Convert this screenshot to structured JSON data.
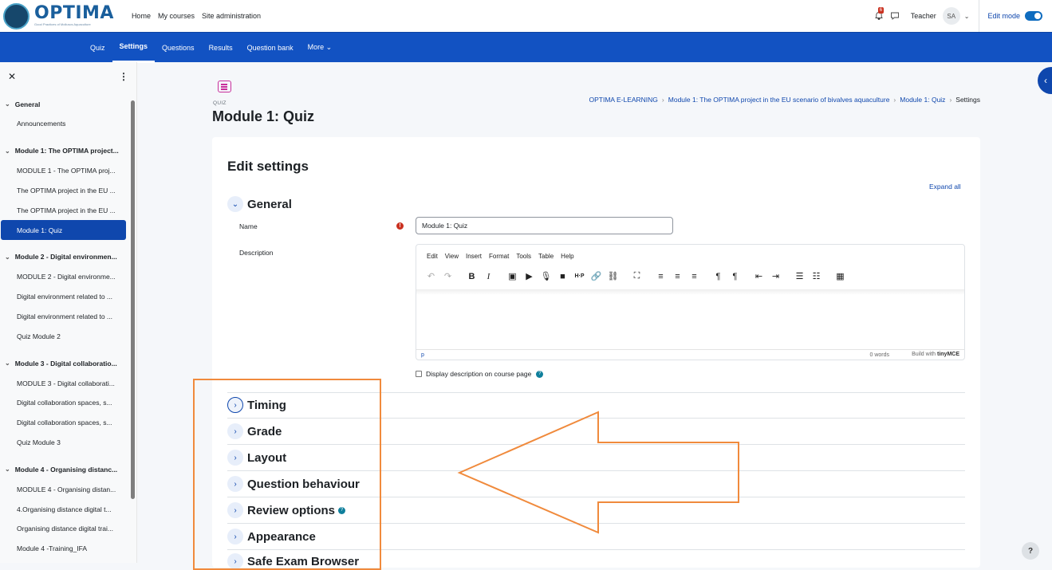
{
  "brand": {
    "title": "OPTIMA",
    "subtitle": "Good Practices of Molluscs Aquaculture"
  },
  "topnav": [
    "Home",
    "My courses",
    "Site administration"
  ],
  "user": {
    "notifications": "6",
    "role": "Teacher",
    "initials": "SA",
    "edit_mode_label": "Edit mode"
  },
  "secnav": [
    "Quiz",
    "Settings",
    "Questions",
    "Results",
    "Question bank",
    "More ⌄"
  ],
  "drawer": {
    "sections": [
      {
        "title": "General",
        "items": [
          "Announcements"
        ]
      },
      {
        "title": "Module 1: The OPTIMA project...",
        "items": [
          "MODULE 1 - The OPTIMA proj...",
          "The OPTIMA project in the EU ...",
          "The OPTIMA project in the EU ...",
          "Module 1: Quiz"
        ]
      },
      {
        "title": "Module 2 - Digital environmen...",
        "items": [
          "MODULE 2 - Digital environme...",
          "Digital environment related to ...",
          "Digital environment related to ...",
          "Quiz Module 2"
        ]
      },
      {
        "title": "Module 3 - Digital collaboratio...",
        "items": [
          "MODULE 3 - Digital collaborati...",
          "Digital collaboration spaces, s...",
          "Digital collaboration spaces, s...",
          "Quiz Module 3"
        ]
      },
      {
        "title": "Module 4 - Organising distanc...",
        "items": [
          "MODULE 4 - Organising distan...",
          "4.Organising distance digital t...",
          "Organising distance digital trai...",
          "Module 4 -Training_IFA"
        ]
      }
    ],
    "active_item": "Module 1: Quiz"
  },
  "page": {
    "type_label": "QUIZ",
    "title": "Module 1: Quiz",
    "breadcrumb": [
      "OPTIMA E-LEARNING",
      "Module 1: The OPTIMA project in the EU scenario of bivalves aquaculture",
      "Module 1: Quiz",
      "Settings"
    ]
  },
  "form": {
    "heading": "Edit settings",
    "expand_all": "Expand all",
    "general_label": "General",
    "name_label": "Name",
    "name_value": "Module 1: Quiz",
    "description_label": "Description",
    "editor_menu": [
      "Edit",
      "View",
      "Insert",
      "Format",
      "Tools",
      "Table",
      "Help"
    ],
    "editor_status_p": "p",
    "editor_words": "0 words",
    "editor_built": "Build with",
    "editor_brand": "tinyMCE",
    "display_desc_label": "Display description on course page",
    "sections": [
      "Timing",
      "Grade",
      "Layout",
      "Question behaviour",
      "Review options",
      "Appearance",
      "Safe Exam Browser"
    ]
  },
  "colors": {
    "primary": "#0f47ad",
    "nav": "#1252c2",
    "annotation": "#f08a3c",
    "quiz_icon": "#c82e9b"
  }
}
